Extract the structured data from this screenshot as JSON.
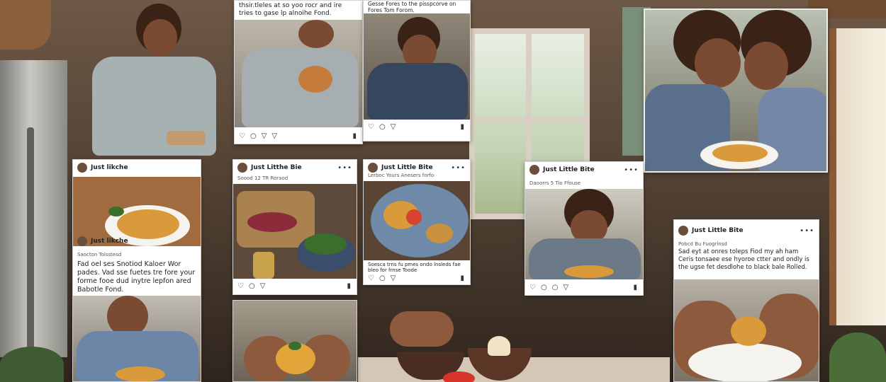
{
  "posts": [
    {
      "caption_top": "thsir.tleles at so yoo rocr and ire tries to gase lp alnoihe Fond."
    },
    {
      "caption_top": "Gesse Fores to the pisspcorve on Fores Tom Forom."
    },
    {
      "username": "Just likche",
      "subtitle": "Saocton Tolsstesd",
      "caption": "Fad oel ses Snotiod Kaloer Wor pades. Vad sse fuetes tre fore your forme fooe dud inytre lepfon ared Babotle Fond."
    },
    {
      "username": "Just Litthe Bie",
      "subtitle": "Soood 12 TR Roraod"
    },
    {
      "username": "Just Little Bite",
      "subtitle": "Lerboc Yours Anesers forfo",
      "caption": "Soesca trns fu pmes ondo lnsleds fae bleo for frnse Toode"
    },
    {
      "username": "Just Little Bite",
      "subtitle": "Daoorrs 5 Tio Ffouse"
    },
    {
      "username": "Just Little Bite",
      "subtitle": "Pobcd Bu Fuogrinsd",
      "caption": "Sad eyt at onres toleps Fiod my ah ham Ceris tonsaee ese hyoroe ctter and ondly is the ugse fet desdlohe to black bale Rolled."
    }
  ],
  "icons": {
    "like": "heart-icon",
    "comment": "comment-icon",
    "share": "share-icon",
    "save": "bookmark-icon",
    "more": "more-options-icon"
  },
  "icon_glyphs": {
    "heart": "♡",
    "comment": "○",
    "share": "▽",
    "bookmark": "▮",
    "more": "•••"
  }
}
